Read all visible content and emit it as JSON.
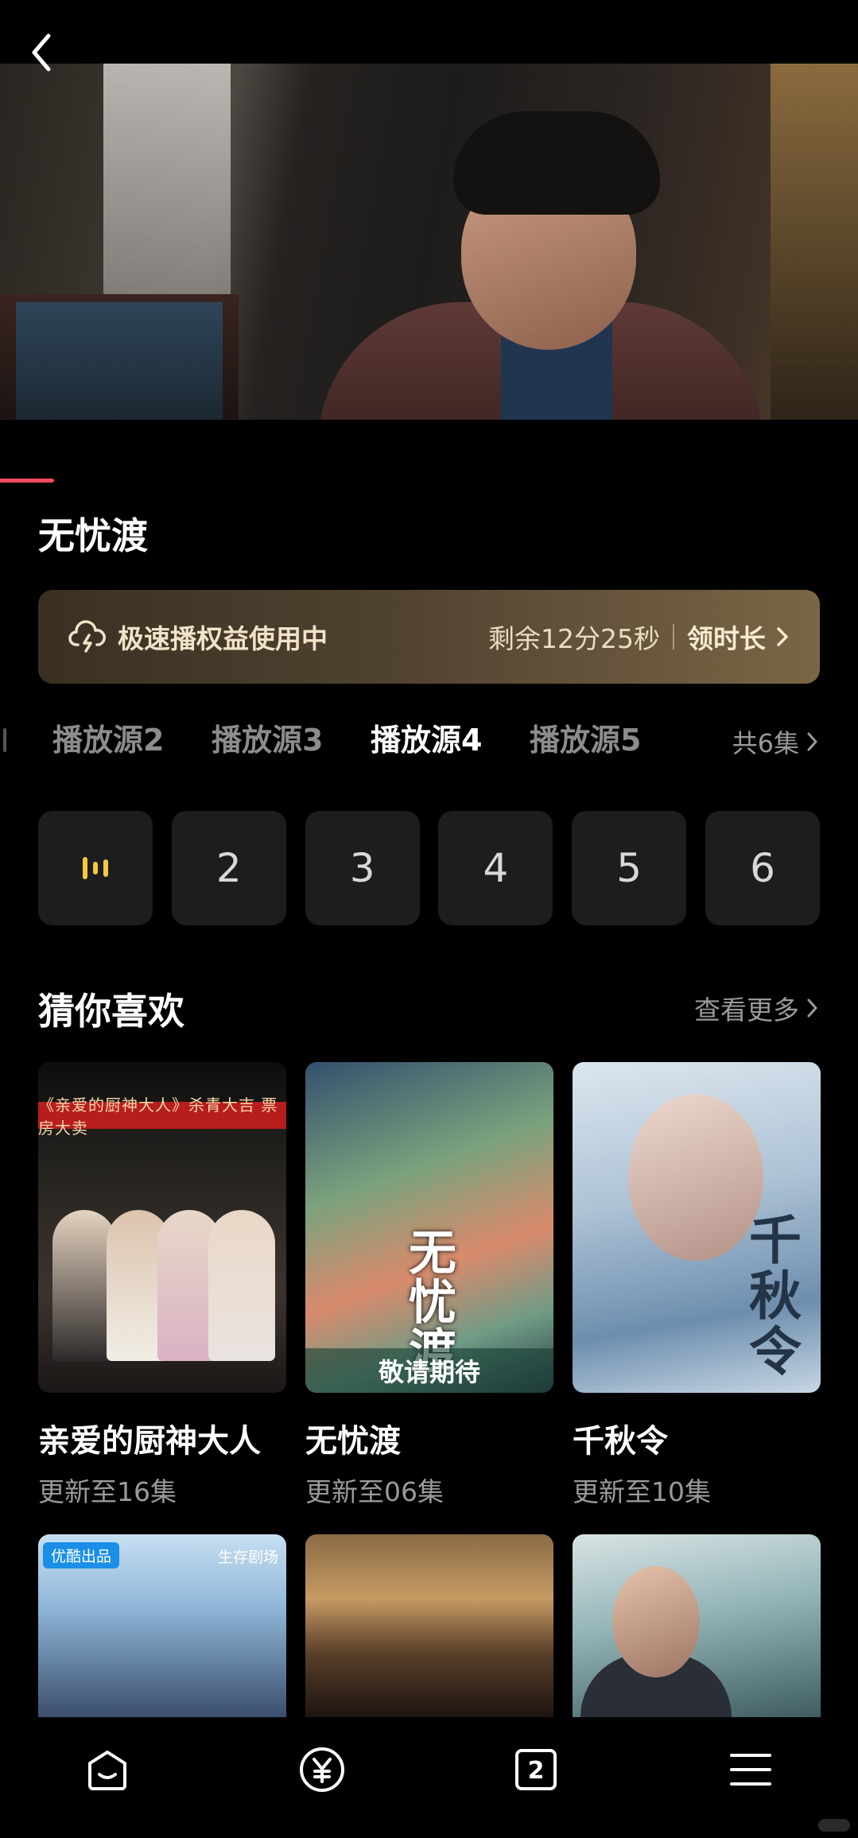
{
  "video": {
    "back_icon": "chevron-left-icon"
  },
  "show": {
    "title": "无忧渡"
  },
  "speed_banner": {
    "icon": "cloud-lightning-icon",
    "text": "极速播权益使用中",
    "remaining": "剩余12分25秒",
    "action": "领时长",
    "accent_color": "#7a6646"
  },
  "sources": {
    "items": [
      "播放源2",
      "播放源3",
      "播放源4",
      "播放源5"
    ],
    "active": "播放源4",
    "total": "共6集"
  },
  "episodes": {
    "items": [
      "2",
      "3",
      "4",
      "5",
      "6"
    ],
    "playing_indicator": "playing-bars-icon",
    "indicator_color": "#f5c842"
  },
  "recommend": {
    "title": "猜你喜欢",
    "more": "查看更多",
    "cards": [
      {
        "name": "亲爱的厨神大人",
        "sub": "更新至16集",
        "poster_text": "《亲爱的厨神大人》杀青大吉  票房大卖"
      },
      {
        "name": "无忧渡",
        "sub": "更新至06集",
        "poster_text": "敬请期待",
        "poster_title": "无忧渡"
      },
      {
        "name": "千秋令",
        "sub": "更新至10集",
        "poster_title": "千秋令"
      }
    ],
    "row2": [
      {
        "badge": "优酷出品",
        "badge2": "生存剧场"
      },
      {},
      {}
    ]
  },
  "nav": {
    "items": [
      "home-icon",
      "yuan-icon",
      "tab-count-icon",
      "menu-icon"
    ],
    "tab_count": "2"
  },
  "colors": {
    "progress": "#ff4a5a",
    "background": "#000000"
  }
}
